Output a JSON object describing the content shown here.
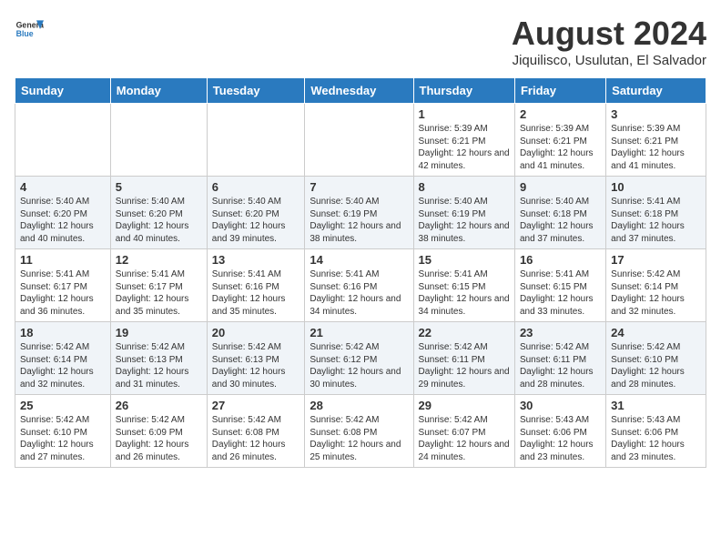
{
  "header": {
    "logo_line1": "General",
    "logo_line2": "Blue",
    "main_title": "August 2024",
    "subtitle": "Jiquilisco, Usulutan, El Salvador"
  },
  "days_of_week": [
    "Sunday",
    "Monday",
    "Tuesday",
    "Wednesday",
    "Thursday",
    "Friday",
    "Saturday"
  ],
  "weeks": [
    [
      {
        "day": "",
        "info": ""
      },
      {
        "day": "",
        "info": ""
      },
      {
        "day": "",
        "info": ""
      },
      {
        "day": "",
        "info": ""
      },
      {
        "day": "1",
        "info": "Sunrise: 5:39 AM\nSunset: 6:21 PM\nDaylight: 12 hours and 42 minutes."
      },
      {
        "day": "2",
        "info": "Sunrise: 5:39 AM\nSunset: 6:21 PM\nDaylight: 12 hours and 41 minutes."
      },
      {
        "day": "3",
        "info": "Sunrise: 5:39 AM\nSunset: 6:21 PM\nDaylight: 12 hours and 41 minutes."
      }
    ],
    [
      {
        "day": "4",
        "info": "Sunrise: 5:40 AM\nSunset: 6:20 PM\nDaylight: 12 hours and 40 minutes."
      },
      {
        "day": "5",
        "info": "Sunrise: 5:40 AM\nSunset: 6:20 PM\nDaylight: 12 hours and 40 minutes."
      },
      {
        "day": "6",
        "info": "Sunrise: 5:40 AM\nSunset: 6:20 PM\nDaylight: 12 hours and 39 minutes."
      },
      {
        "day": "7",
        "info": "Sunrise: 5:40 AM\nSunset: 6:19 PM\nDaylight: 12 hours and 38 minutes."
      },
      {
        "day": "8",
        "info": "Sunrise: 5:40 AM\nSunset: 6:19 PM\nDaylight: 12 hours and 38 minutes."
      },
      {
        "day": "9",
        "info": "Sunrise: 5:40 AM\nSunset: 6:18 PM\nDaylight: 12 hours and 37 minutes."
      },
      {
        "day": "10",
        "info": "Sunrise: 5:41 AM\nSunset: 6:18 PM\nDaylight: 12 hours and 37 minutes."
      }
    ],
    [
      {
        "day": "11",
        "info": "Sunrise: 5:41 AM\nSunset: 6:17 PM\nDaylight: 12 hours and 36 minutes."
      },
      {
        "day": "12",
        "info": "Sunrise: 5:41 AM\nSunset: 6:17 PM\nDaylight: 12 hours and 35 minutes."
      },
      {
        "day": "13",
        "info": "Sunrise: 5:41 AM\nSunset: 6:16 PM\nDaylight: 12 hours and 35 minutes."
      },
      {
        "day": "14",
        "info": "Sunrise: 5:41 AM\nSunset: 6:16 PM\nDaylight: 12 hours and 34 minutes."
      },
      {
        "day": "15",
        "info": "Sunrise: 5:41 AM\nSunset: 6:15 PM\nDaylight: 12 hours and 34 minutes."
      },
      {
        "day": "16",
        "info": "Sunrise: 5:41 AM\nSunset: 6:15 PM\nDaylight: 12 hours and 33 minutes."
      },
      {
        "day": "17",
        "info": "Sunrise: 5:42 AM\nSunset: 6:14 PM\nDaylight: 12 hours and 32 minutes."
      }
    ],
    [
      {
        "day": "18",
        "info": "Sunrise: 5:42 AM\nSunset: 6:14 PM\nDaylight: 12 hours and 32 minutes."
      },
      {
        "day": "19",
        "info": "Sunrise: 5:42 AM\nSunset: 6:13 PM\nDaylight: 12 hours and 31 minutes."
      },
      {
        "day": "20",
        "info": "Sunrise: 5:42 AM\nSunset: 6:13 PM\nDaylight: 12 hours and 30 minutes."
      },
      {
        "day": "21",
        "info": "Sunrise: 5:42 AM\nSunset: 6:12 PM\nDaylight: 12 hours and 30 minutes."
      },
      {
        "day": "22",
        "info": "Sunrise: 5:42 AM\nSunset: 6:11 PM\nDaylight: 12 hours and 29 minutes."
      },
      {
        "day": "23",
        "info": "Sunrise: 5:42 AM\nSunset: 6:11 PM\nDaylight: 12 hours and 28 minutes."
      },
      {
        "day": "24",
        "info": "Sunrise: 5:42 AM\nSunset: 6:10 PM\nDaylight: 12 hours and 28 minutes."
      }
    ],
    [
      {
        "day": "25",
        "info": "Sunrise: 5:42 AM\nSunset: 6:10 PM\nDaylight: 12 hours and 27 minutes."
      },
      {
        "day": "26",
        "info": "Sunrise: 5:42 AM\nSunset: 6:09 PM\nDaylight: 12 hours and 26 minutes."
      },
      {
        "day": "27",
        "info": "Sunrise: 5:42 AM\nSunset: 6:08 PM\nDaylight: 12 hours and 26 minutes."
      },
      {
        "day": "28",
        "info": "Sunrise: 5:42 AM\nSunset: 6:08 PM\nDaylight: 12 hours and 25 minutes."
      },
      {
        "day": "29",
        "info": "Sunrise: 5:42 AM\nSunset: 6:07 PM\nDaylight: 12 hours and 24 minutes."
      },
      {
        "day": "30",
        "info": "Sunrise: 5:43 AM\nSunset: 6:06 PM\nDaylight: 12 hours and 23 minutes."
      },
      {
        "day": "31",
        "info": "Sunrise: 5:43 AM\nSunset: 6:06 PM\nDaylight: 12 hours and 23 minutes."
      }
    ]
  ]
}
